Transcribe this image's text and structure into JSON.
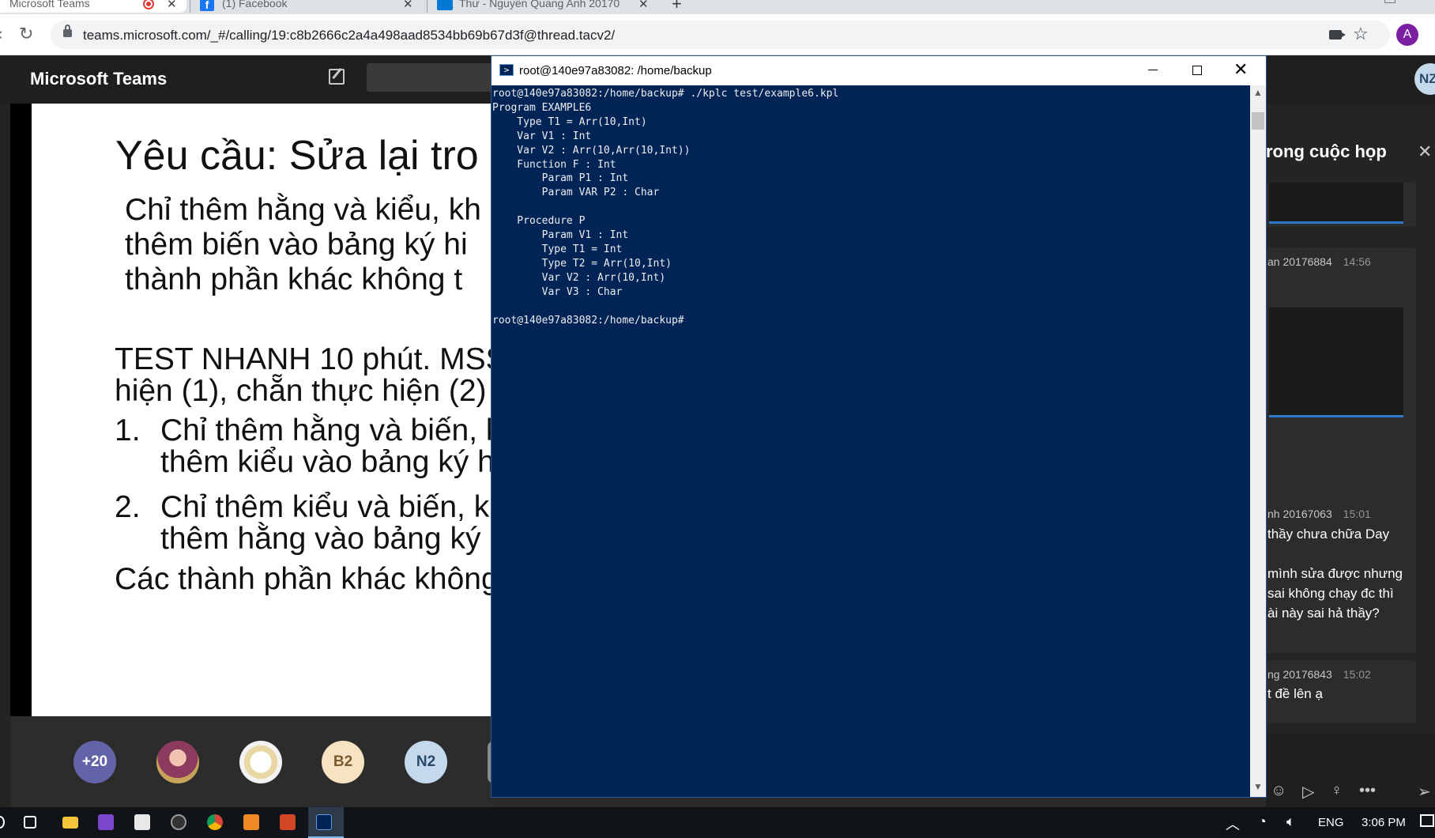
{
  "browser": {
    "tabs": [
      {
        "label": "Microsoft Teams",
        "close": "✕"
      },
      {
        "label": "(1) Facebook",
        "favicon": "f",
        "close": "✕"
      },
      {
        "label": "Thư - Nguyễn Quang Anh 20170",
        "close": "✕"
      }
    ],
    "new_tab": "+",
    "url": "teams.microsoft.com/_#/calling/19:c8b2666c2a4a498aad8534bb69b67d3f@thread.tacv2/",
    "profile_initial": "A"
  },
  "teams": {
    "title": "Microsoft Teams",
    "user_initials": "NZ",
    "slide": {
      "title": "Yêu cầu: Sửa lại tro",
      "para1": [
        "Chỉ thêm hằng và kiểu, kh",
        "thêm biến vào bảng ký hi",
        "thành phần khác không t"
      ],
      "test_line1": "TEST NHANH 10 phút. MSSV",
      "test_line2": "hiện (1), chẵn thực hiện (2)",
      "item1_num": "1.",
      "item1_line1": "Chỉ thêm hằng và biến, k",
      "item1_line2": "thêm kiểu vào bảng ký h",
      "item2_num": "2.",
      "item2_line1": "Chỉ thêm kiểu và biến, k",
      "item2_line2": "thêm hằng vào bảng ký",
      "footer": "Các thành phần khác không"
    },
    "participants": [
      {
        "label": "+20"
      },
      {
        "label": ""
      },
      {
        "label": ""
      },
      {
        "label": "B2"
      },
      {
        "label": "N2"
      }
    ],
    "chat": {
      "title": "rong cuộc họp",
      "messages": [
        {
          "author": "an 20176884",
          "time": "14:56"
        },
        {
          "author": "nh 20167063",
          "time": "15:01",
          "lines": [
            "thầy chưa chữa Day",
            "mình sửa được nhưng",
            "sai không chạy đc thì",
            "ài này sai hả thầy?"
          ]
        },
        {
          "author": "ng 20176843",
          "time": "15:02",
          "lines": [
            "t đề lên ạ"
          ]
        }
      ]
    }
  },
  "terminal": {
    "title": "root@140e97a83082: /home/backup",
    "lines": [
      "root@140e97a83082:/home/backup# ./kplc test/example6.kpl",
      "Program EXAMPLE6",
      "    Type T1 = Arr(10,Int)",
      "    Var V1 : Int",
      "    Var V2 : Arr(10,Arr(10,Int))",
      "    Function F : Int",
      "        Param P1 : Int",
      "        Param VAR P2 : Char",
      "",
      "    Procedure P",
      "        Param V1 : Int",
      "        Type T1 = Int",
      "        Type T2 = Arr(10,Int)",
      "        Var V2 : Arr(10,Int)",
      "        Var V3 : Char",
      "",
      "root@140e97a83082:/home/backup#"
    ]
  },
  "taskbar": {
    "language": "ENG",
    "clock": "3:06 PM"
  }
}
